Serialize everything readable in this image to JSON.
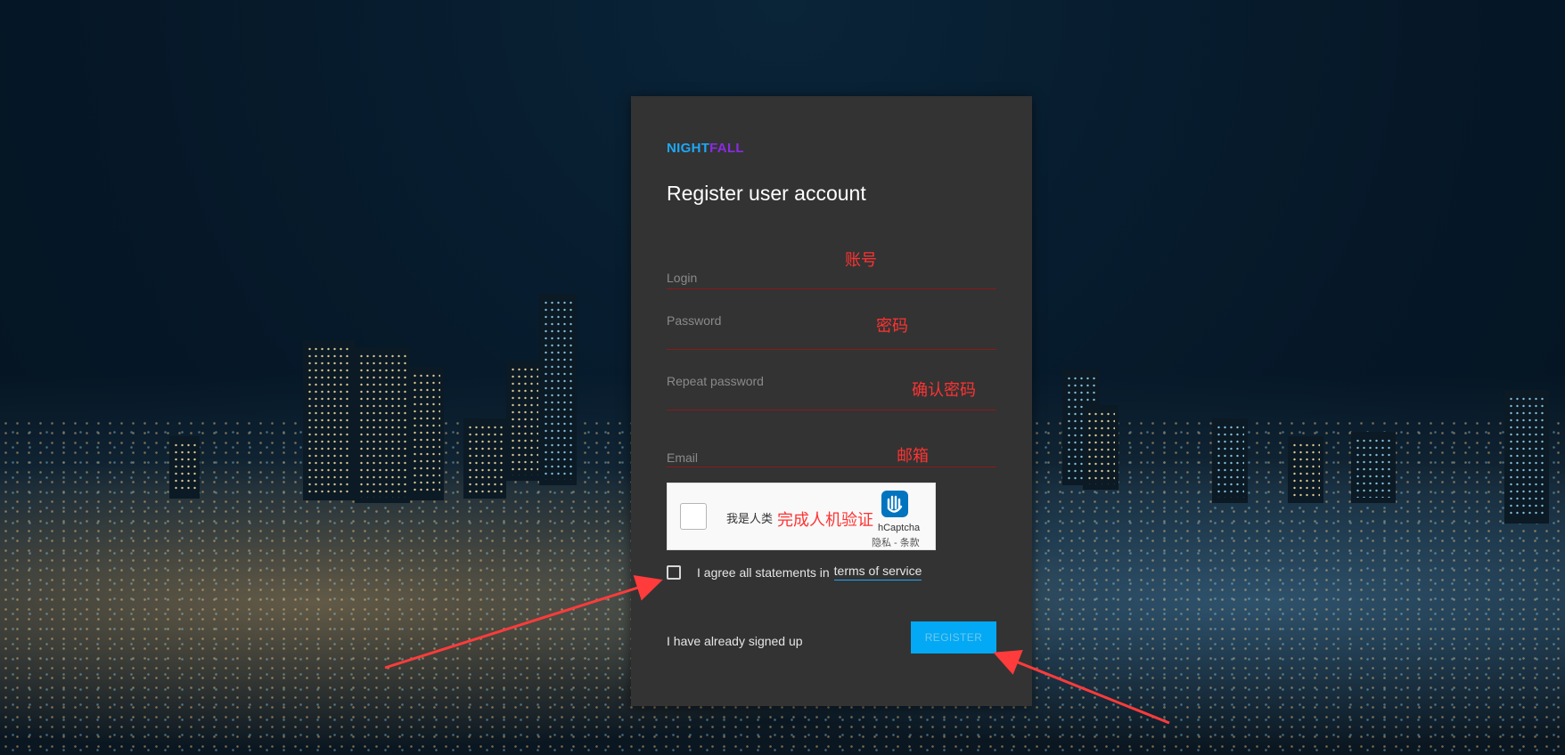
{
  "brand": {
    "part1": "NIGHT",
    "part2": "FALL"
  },
  "title": "Register user account",
  "fields": {
    "login": {
      "placeholder": "Login",
      "annotation": "账号"
    },
    "password": {
      "placeholder": "Password",
      "annotation": "密码"
    },
    "repeat_password": {
      "placeholder": "Repeat password",
      "annotation": "确认密码"
    },
    "email": {
      "placeholder": "Email",
      "annotation": "邮箱"
    }
  },
  "captcha": {
    "label": "我是人类",
    "annotation": "完成人机验证",
    "brand": "hCaptcha",
    "links": "隐私 - 条款"
  },
  "agree": {
    "text": "I agree all statements in",
    "link": "terms of service"
  },
  "signed_up_link": "I have already signed up",
  "register_button": "REGISTER",
  "colors": {
    "accent": "#03a9f4",
    "brand_blue": "#1ea7f5",
    "brand_purple": "#8a2be2",
    "annotation_red": "#ff3333",
    "card_bg": "#333333"
  }
}
